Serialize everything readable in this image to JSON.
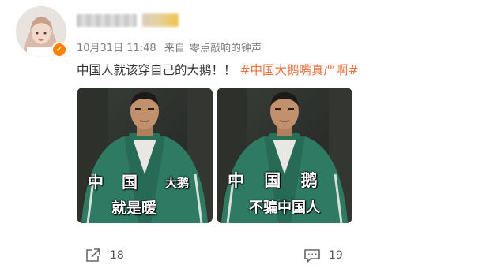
{
  "post": {
    "timestamp": "10月31日 11:48",
    "source_prefix": "来自",
    "source_name": "零点敲响的钟声",
    "text": "中国人就该穿自己的大鹅！！",
    "hashtag": "#中国大鹅嘴真严啊#"
  },
  "images": [
    {
      "jacket_text": "中 国",
      "caption_small": "大鹅",
      "caption_main": "就是暖"
    },
    {
      "jacket_text": "中 国 鹅",
      "caption_main": "不骗中国人"
    }
  ],
  "actions": {
    "repost_count": "18",
    "comment_count": "19"
  },
  "colors": {
    "hashtag": "#eb7340",
    "verified_badge": "#ff8200",
    "meta_text": "#808080"
  },
  "icons": [
    "verified-icon",
    "repost-icon",
    "comment-icon"
  ]
}
